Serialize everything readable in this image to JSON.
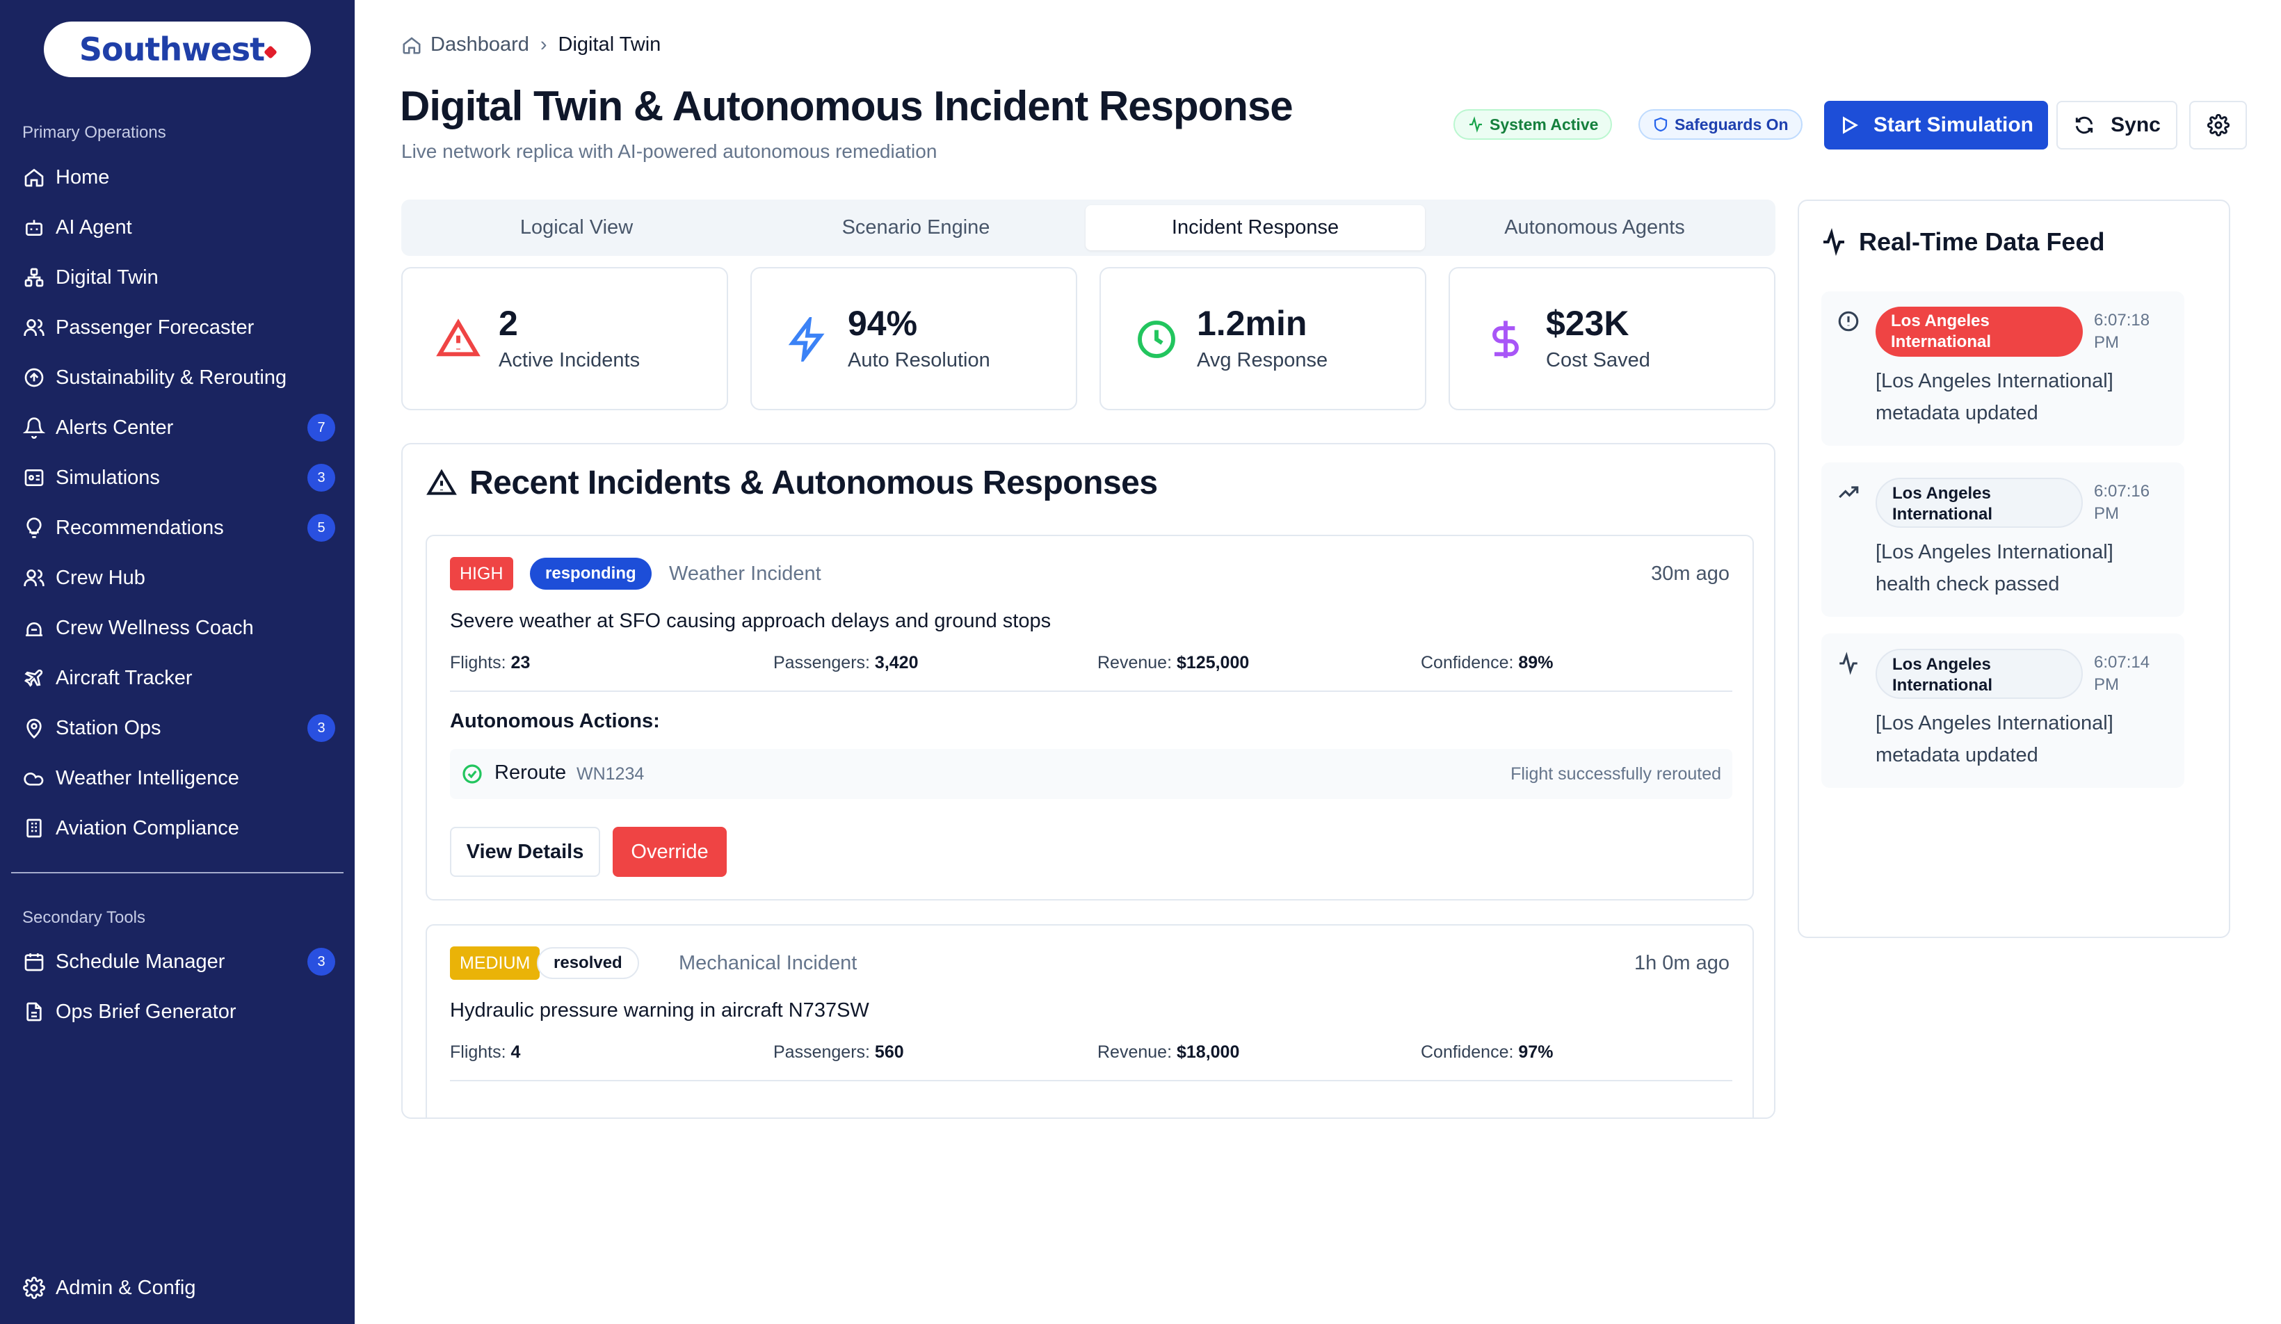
{
  "brand": {
    "name": "Southwest"
  },
  "sidebar": {
    "primary_title": "Primary Operations",
    "primary_items": [
      {
        "label": "Home",
        "icon": "home-icon",
        "badge": ""
      },
      {
        "label": "AI Agent",
        "icon": "bot-icon",
        "badge": ""
      },
      {
        "label": "Digital Twin",
        "icon": "network-icon",
        "badge": ""
      },
      {
        "label": "Passenger Forecaster",
        "icon": "users-icon",
        "badge": ""
      },
      {
        "label": "Sustainability & Rerouting",
        "icon": "circle-arrow-icon",
        "badge": ""
      },
      {
        "label": "Alerts Center",
        "icon": "bell-icon",
        "badge": "7"
      },
      {
        "label": "Simulations",
        "icon": "simulation-icon",
        "badge": "3"
      },
      {
        "label": "Recommendations",
        "icon": "lightbulb-icon",
        "badge": "5"
      },
      {
        "label": "Crew Hub",
        "icon": "users-icon",
        "badge": ""
      },
      {
        "label": "Crew Wellness Coach",
        "icon": "wellness-icon",
        "badge": ""
      },
      {
        "label": "Aircraft Tracker",
        "icon": "plane-icon",
        "badge": ""
      },
      {
        "label": "Station Ops",
        "icon": "map-pin-icon",
        "badge": "3"
      },
      {
        "label": "Weather Intelligence",
        "icon": "cloud-icon",
        "badge": ""
      },
      {
        "label": "Aviation Compliance",
        "icon": "building-icon",
        "badge": ""
      }
    ],
    "secondary_title": "Secondary Tools",
    "secondary_items": [
      {
        "label": "Schedule Manager",
        "icon": "calendar-icon",
        "badge": "3"
      },
      {
        "label": "Ops Brief Generator",
        "icon": "file-icon",
        "badge": ""
      }
    ],
    "footer_item": {
      "label": "Admin & Config",
      "icon": "gear-icon"
    }
  },
  "breadcrumb": {
    "root": "Dashboard",
    "current": "Digital Twin"
  },
  "header": {
    "title": "Digital Twin & Autonomous Incident Response",
    "subtitle": "Live network replica with AI-powered autonomous remediation",
    "status_pill": "System Active",
    "safeguards_pill": "Safeguards On",
    "start_button": "Start Simulation",
    "sync_button": "Sync"
  },
  "tabs": [
    {
      "label": "Logical View",
      "active": false
    },
    {
      "label": "Scenario Engine",
      "active": false
    },
    {
      "label": "Incident Response",
      "active": true
    },
    {
      "label": "Autonomous Agents",
      "active": false
    }
  ],
  "stats": [
    {
      "value": "2",
      "label": "Active Incidents",
      "icon": "alert-triangle-icon",
      "color": "#ef4444"
    },
    {
      "value": "94%",
      "label": "Auto Resolution",
      "icon": "zap-icon",
      "color": "#3b82f6"
    },
    {
      "value": "1.2min",
      "label": "Avg Response",
      "icon": "clock-icon",
      "color": "#22c55e"
    },
    {
      "value": "$23K",
      "label": "Cost Saved",
      "icon": "dollar-icon",
      "color": "#a855f7"
    }
  ],
  "incidents_section": {
    "title": "Recent Incidents & Autonomous Responses",
    "labels": {
      "flights": "Flights:",
      "passengers": "Passengers:",
      "revenue": "Revenue:",
      "confidence": "Confidence:"
    },
    "items": [
      {
        "severity": "HIGH",
        "status": "responding",
        "type": "Weather Incident",
        "time": "30m ago",
        "description": "Severe weather at SFO causing approach delays and ground stops",
        "flights": "23",
        "passengers": "3,420",
        "revenue": "$125,000",
        "confidence": "89%",
        "actions_title": "Autonomous Actions:",
        "action": {
          "name": "Reroute",
          "flight": "WN1234",
          "result": "Flight successfully rerouted"
        },
        "view_button": "View Details",
        "override_button": "Override"
      },
      {
        "severity": "MEDIUM",
        "status": "resolved",
        "type": "Mechanical Incident",
        "time": "1h 0m ago",
        "description": "Hydraulic pressure warning in aircraft N737SW",
        "flights": "4",
        "passengers": "560",
        "revenue": "$18,000",
        "confidence": "97%"
      }
    ]
  },
  "feed": {
    "title": "Real-Time Data Feed",
    "items": [
      {
        "icon": "alert-circle-icon",
        "tag": "Los Angeles International",
        "tag_style": "red",
        "time": "6:07:18 PM",
        "message": "[Los Angeles International] metadata updated"
      },
      {
        "icon": "trending-up-icon",
        "tag": "Los Angeles International",
        "tag_style": "gray",
        "time": "6:07:16 PM",
        "message": "[Los Angeles International] health check passed"
      },
      {
        "icon": "activity-icon",
        "tag": "Los Angeles International",
        "tag_style": "gray",
        "time": "6:07:14 PM",
        "message": "[Los Angeles International] metadata updated"
      }
    ]
  }
}
